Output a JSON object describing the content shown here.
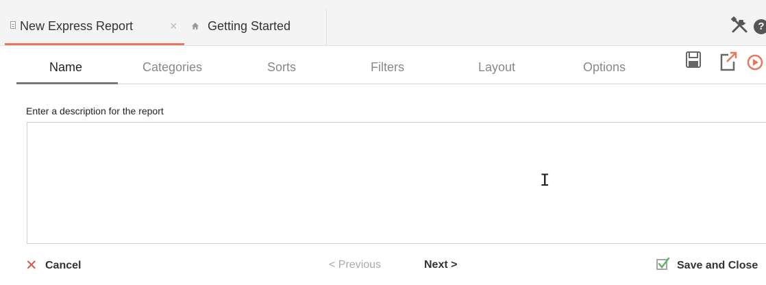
{
  "tabs": [
    {
      "label": "New Express Report",
      "close": "×",
      "active": true
    },
    {
      "label": "Getting Started",
      "icon": "home-icon"
    }
  ],
  "toolbar": {
    "tools_icon": "tools-icon",
    "help_icon": "help-icon",
    "help_glyph": "?"
  },
  "wizard_tabs": [
    "Name",
    "Categories",
    "Sorts",
    "Filters",
    "Layout",
    "Options"
  ],
  "wizard_active": "Name",
  "actions": [
    "save-icon",
    "export-icon",
    "run-icon"
  ],
  "description": {
    "label": "Enter a description for the report",
    "value": ""
  },
  "footer": {
    "cancel": "Cancel",
    "previous": "< Previous",
    "next": "Next >",
    "save_close": "Save and Close"
  },
  "colors": {
    "accent": "#e8765a",
    "cancel": "#d9534f",
    "check": "#5cb85c"
  }
}
